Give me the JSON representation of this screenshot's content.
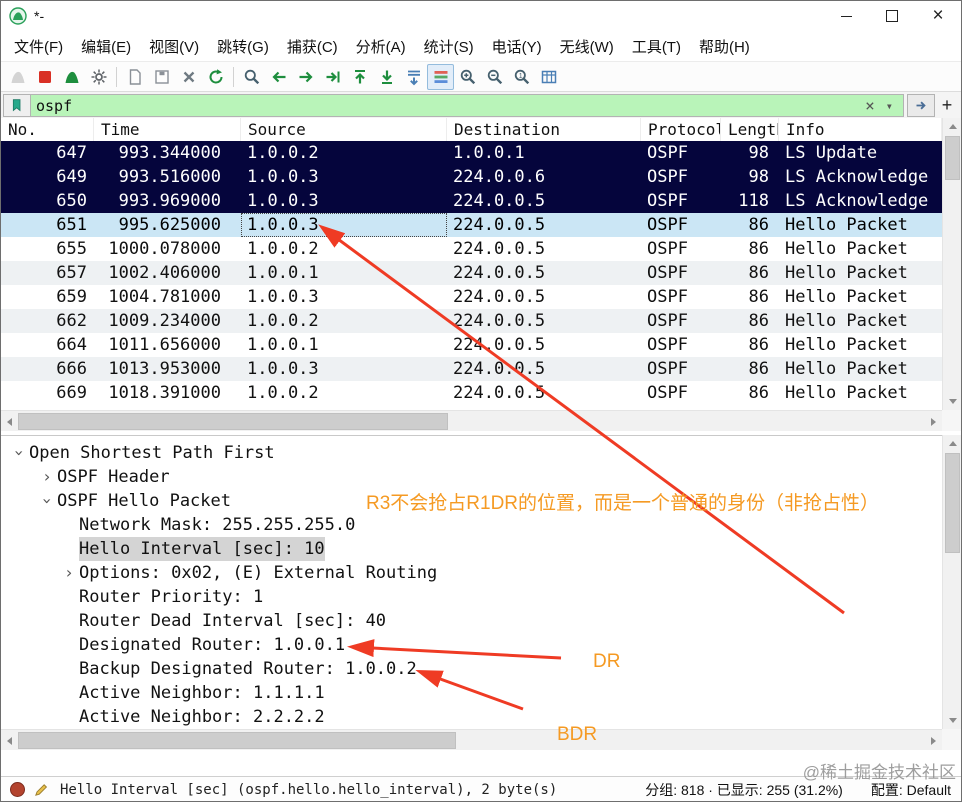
{
  "window": {
    "title": "*-",
    "close_glyph": "×"
  },
  "menu_bar": {
    "items": [
      {
        "name": "menu-file",
        "label": "文件(F)"
      },
      {
        "name": "menu-edit",
        "label": "编辑(E)"
      },
      {
        "name": "menu-view",
        "label": "视图(V)"
      },
      {
        "name": "menu-go",
        "label": "跳转(G)"
      },
      {
        "name": "menu-capture",
        "label": "捕获(C)"
      },
      {
        "name": "menu-analyze",
        "label": "分析(A)"
      },
      {
        "name": "menu-statistics",
        "label": "统计(S)"
      },
      {
        "name": "menu-telephony",
        "label": "电话(Y)"
      },
      {
        "name": "menu-wireless",
        "label": "无线(W)"
      },
      {
        "name": "menu-tools",
        "label": "工具(T)"
      },
      {
        "name": "menu-help",
        "label": "帮助(H)"
      }
    ]
  },
  "toolbar": {
    "items": [
      {
        "type": "btn",
        "name": "start-capture-button",
        "icon": "shark-fin",
        "disabled": true
      },
      {
        "type": "btn",
        "name": "stop-capture-button",
        "icon": "stop-square"
      },
      {
        "type": "btn",
        "name": "restart-capture-button",
        "icon": "shark-fin-restart"
      },
      {
        "type": "btn",
        "name": "capture-options-button",
        "icon": "gear"
      },
      {
        "type": "sep"
      },
      {
        "type": "btn",
        "name": "open-file-button",
        "icon": "document"
      },
      {
        "type": "btn",
        "name": "save-file-button",
        "icon": "floppy"
      },
      {
        "type": "btn",
        "name": "close-capture-button",
        "icon": "close-x"
      },
      {
        "type": "btn",
        "name": "reload-button",
        "icon": "reload-arrow"
      },
      {
        "type": "sep"
      },
      {
        "type": "btn",
        "name": "find-packet-button",
        "icon": "magnifier"
      },
      {
        "type": "btn",
        "name": "go-back-button",
        "icon": "arrow-left"
      },
      {
        "type": "btn",
        "name": "go-forward-button",
        "icon": "arrow-right"
      },
      {
        "type": "btn",
        "name": "go-to-packet-button",
        "icon": "arrow-goto"
      },
      {
        "type": "btn",
        "name": "go-top-button",
        "icon": "arrow-top"
      },
      {
        "type": "btn",
        "name": "go-bottom-button",
        "icon": "arrow-bottom"
      },
      {
        "type": "btn",
        "name": "auto-scroll-toggle",
        "icon": "auto-scroll"
      },
      {
        "type": "btn",
        "name": "colorize-toggle",
        "icon": "colorize-list",
        "pressed": true
      },
      {
        "type": "btn",
        "name": "zoom-in-button",
        "icon": "zoom-in"
      },
      {
        "type": "btn",
        "name": "zoom-out-button",
        "icon": "zoom-out"
      },
      {
        "type": "btn",
        "name": "zoom-original-button",
        "icon": "zoom-original"
      },
      {
        "type": "btn",
        "name": "resize-columns-button",
        "icon": "table-columns"
      }
    ]
  },
  "filter_bar": {
    "value": "ospf",
    "clear_glyph": "×",
    "caret_glyph": "▾",
    "add_glyph": "+"
  },
  "packet_list": {
    "columns": [
      "No.",
      "Time",
      "Source",
      "Destination",
      "Protocol",
      "Length",
      "Info"
    ],
    "rows": [
      {
        "no": "647",
        "time": "993.344000",
        "source": "1.0.0.2",
        "destination": "1.0.0.1",
        "protocol": "OSPF",
        "length": "98",
        "info": "LS Update",
        "style": "routing-dark"
      },
      {
        "no": "649",
        "time": "993.516000",
        "source": "1.0.0.3",
        "destination": "224.0.0.6",
        "protocol": "OSPF",
        "length": "98",
        "info": "LS Acknowledge",
        "style": "routing-dark"
      },
      {
        "no": "650",
        "time": "993.969000",
        "source": "1.0.0.3",
        "destination": "224.0.0.5",
        "protocol": "OSPF",
        "length": "118",
        "info": "LS Acknowledge",
        "style": "routing-dark"
      },
      {
        "no": "651",
        "time": "995.625000",
        "source": "1.0.0.3",
        "destination": "224.0.0.5",
        "protocol": "OSPF",
        "length": "86",
        "info": "Hello Packet",
        "style": "selected"
      },
      {
        "no": "655",
        "time": "1000.078000",
        "source": "1.0.0.2",
        "destination": "224.0.0.5",
        "protocol": "OSPF",
        "length": "86",
        "info": "Hello Packet",
        "style": "even"
      },
      {
        "no": "657",
        "time": "1002.406000",
        "source": "1.0.0.1",
        "destination": "224.0.0.5",
        "protocol": "OSPF",
        "length": "86",
        "info": "Hello Packet",
        "style": "odd"
      },
      {
        "no": "659",
        "time": "1004.781000",
        "source": "1.0.0.3",
        "destination": "224.0.0.5",
        "protocol": "OSPF",
        "length": "86",
        "info": "Hello Packet",
        "style": "even"
      },
      {
        "no": "662",
        "time": "1009.234000",
        "source": "1.0.0.2",
        "destination": "224.0.0.5",
        "protocol": "OSPF",
        "length": "86",
        "info": "Hello Packet",
        "style": "odd"
      },
      {
        "no": "664",
        "time": "1011.656000",
        "source": "1.0.0.1",
        "destination": "224.0.0.5",
        "protocol": "OSPF",
        "length": "86",
        "info": "Hello Packet",
        "style": "even"
      },
      {
        "no": "666",
        "time": "1013.953000",
        "source": "1.0.0.3",
        "destination": "224.0.0.5",
        "protocol": "OSPF",
        "length": "86",
        "info": "Hello Packet",
        "style": "odd"
      },
      {
        "no": "669",
        "time": "1018.391000",
        "source": "1.0.0.2",
        "destination": "224.0.0.5",
        "protocol": "OSPF",
        "length": "86",
        "info": "Hello Packet",
        "style": "even"
      }
    ]
  },
  "detail_tree": {
    "lines": [
      {
        "name": "tree-root-ospf",
        "text": "Open Shortest Path First",
        "indent": 0,
        "chev": "open"
      },
      {
        "name": "tree-ospf-header",
        "text": "OSPF Header",
        "indent": 1,
        "chev": "closed"
      },
      {
        "name": "tree-hello-packet",
        "text": "OSPF Hello Packet",
        "indent": 1,
        "chev": "open"
      },
      {
        "name": "tree-network-mask",
        "text": "Network Mask: 255.255.255.0",
        "indent": 2
      },
      {
        "name": "tree-hello-interval",
        "text": "Hello Interval [sec]: 10",
        "indent": 2,
        "selected": true
      },
      {
        "name": "tree-options",
        "text": "Options: 0x02, (E) External Routing",
        "indent": 2,
        "chev": "closed"
      },
      {
        "name": "tree-router-priority",
        "text": "Router Priority: 1",
        "indent": 2
      },
      {
        "name": "tree-dead-interval",
        "text": "Router Dead Interval [sec]: 40",
        "indent": 2
      },
      {
        "name": "tree-designated-router",
        "text": "Designated Router: 1.0.0.1",
        "indent": 2
      },
      {
        "name": "tree-backup-designated-router",
        "text": "Backup Designated Router: 1.0.0.2",
        "indent": 2
      },
      {
        "name": "tree-active-neighbor-1",
        "text": "Active Neighbor: 1.1.1.1",
        "indent": 2
      },
      {
        "name": "tree-active-neighbor-2",
        "text": "Active Neighbor: 2.2.2.2",
        "indent": 2
      }
    ]
  },
  "annotations": {
    "note_text": "R3不会抢占R1DR的位置，而是一个普通的身份（非抢占性）",
    "dr_label": "DR",
    "bdr_label": "BDR"
  },
  "status_bar": {
    "field_info": "Hello Interval [sec] (ospf.hello.hello_interval), 2 byte(s)",
    "packet_stats": "分组: 818 · 已显示: 255 (31.2%)",
    "profile": "配置: Default"
  },
  "watermark": {
    "text": "@稀土掘金技术社区"
  },
  "colors": {
    "filter_valid": "#b9f4b9",
    "row_dark": "#05053c",
    "selected_row": "#cbe6f5",
    "annotation_red": "#ef3b24",
    "annotation_orange": "#f59a23"
  }
}
